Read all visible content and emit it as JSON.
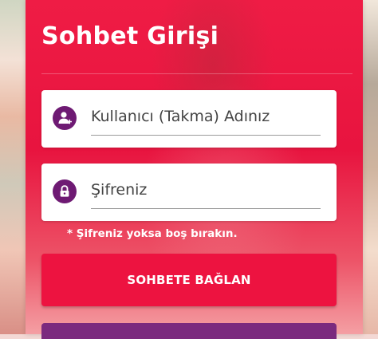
{
  "login": {
    "title": "Sohbet Girişi",
    "username_placeholder": "Kullanıcı (Takma) Adınız",
    "password_placeholder": "Şifreniz",
    "hint": "* Şifreniz yoksa boş bırakın.",
    "connect_label": "SOHBETE BAĞLAN"
  },
  "icons": {
    "username": "user-add-icon",
    "password": "lock-icon"
  },
  "colors": {
    "panel_red": "#ee1c45",
    "icon_purple": "#6e1a73",
    "button_red": "#ed1340",
    "bottom_purple": "#7b2a7e"
  }
}
